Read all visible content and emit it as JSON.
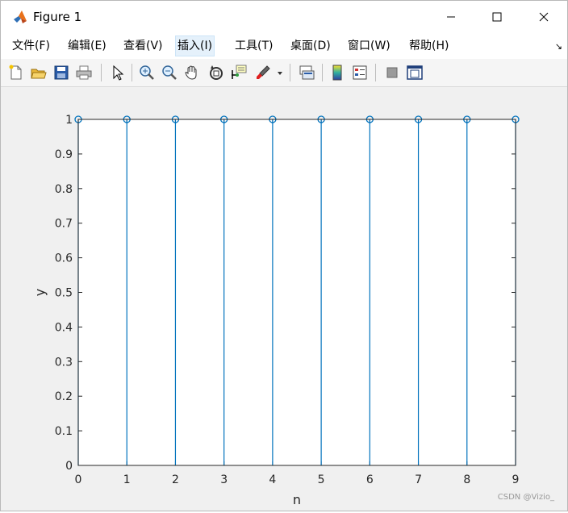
{
  "window": {
    "title": "Figure 1"
  },
  "menu": {
    "items": [
      {
        "label": "文件(F)"
      },
      {
        "label": "编辑(E)"
      },
      {
        "label": "查看(V)"
      },
      {
        "label": "插入(I)"
      },
      {
        "label": "工具(T)"
      },
      {
        "label": "桌面(D)"
      },
      {
        "label": "窗口(W)"
      },
      {
        "label": "帮助(H)"
      }
    ],
    "active_index": 3
  },
  "toolbar": {
    "icons": [
      "new-figure-icon",
      "open-file-icon",
      "save-icon",
      "print-icon",
      "pointer-icon",
      "zoom-in-icon",
      "zoom-out-icon",
      "pan-hand-icon",
      "rotate-3d-icon",
      "data-cursor-icon",
      "brush-icon",
      "link-plot-icon",
      "colorbar-icon",
      "legend-icon",
      "hide-plot-tools-icon",
      "show-plot-tools-icon"
    ]
  },
  "watermark": "CSDN @Vizio_",
  "colors": {
    "stem": "#0072bd",
    "axes": "#262626"
  },
  "chart_data": {
    "type": "stem",
    "x": [
      0,
      1,
      2,
      3,
      4,
      5,
      6,
      7,
      8,
      9
    ],
    "y": [
      1,
      1,
      1,
      1,
      1,
      1,
      1,
      1,
      1,
      1
    ],
    "xlabel": "n",
    "ylabel": "y",
    "xlim": [
      0,
      9
    ],
    "ylim": [
      0,
      1
    ],
    "xticks": [
      "0",
      "1",
      "2",
      "3",
      "4",
      "5",
      "6",
      "7",
      "8",
      "9"
    ],
    "yticks": [
      "0",
      "0.1",
      "0.2",
      "0.3",
      "0.4",
      "0.5",
      "0.6",
      "0.7",
      "0.8",
      "0.9",
      "1"
    ],
    "grid": false
  }
}
